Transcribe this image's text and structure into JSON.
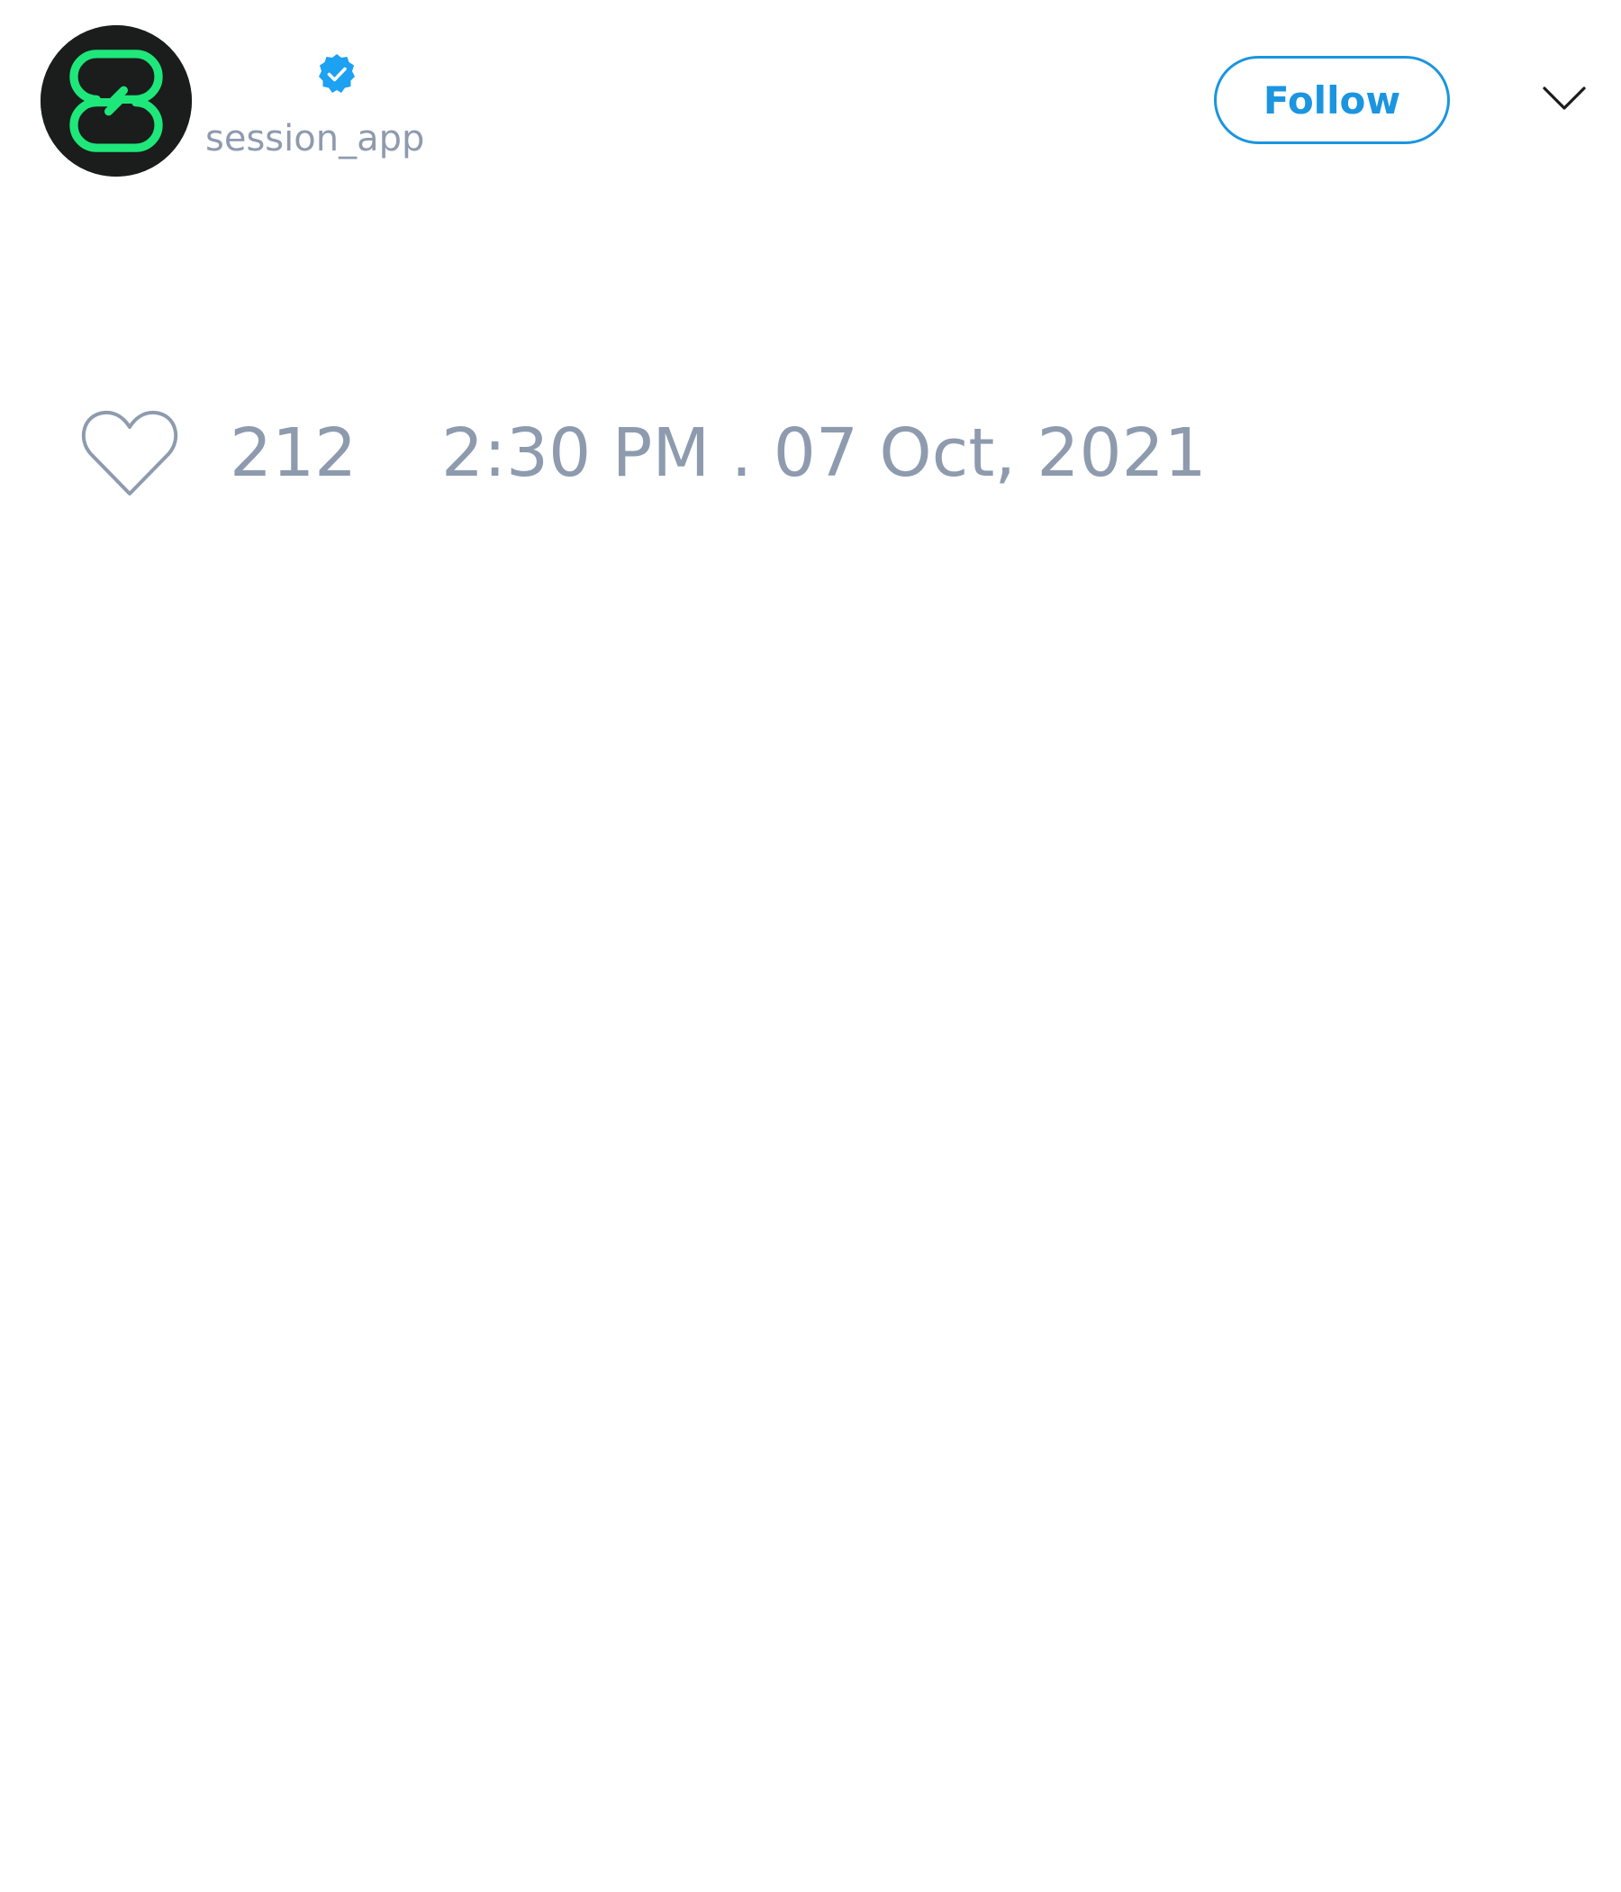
{
  "tweet": {
    "author": {
      "handle": "session_app",
      "verified": true,
      "avatar_icon": "session-logo-icon",
      "verified_icon": "verified-badge-icon"
    },
    "follow_label": "Follow",
    "menu_icon": "chevron-down-icon",
    "like_icon": "heart-icon",
    "like_count": "212",
    "timestamp": "2:30 PM . 07 Oct, 2021"
  },
  "colors": {
    "accent": "#1b95e0",
    "verified": "#1da1f2",
    "muted_text": "#8e9bae",
    "avatar_bg": "#1a1d1c",
    "logo_green": "#1ee87a"
  }
}
